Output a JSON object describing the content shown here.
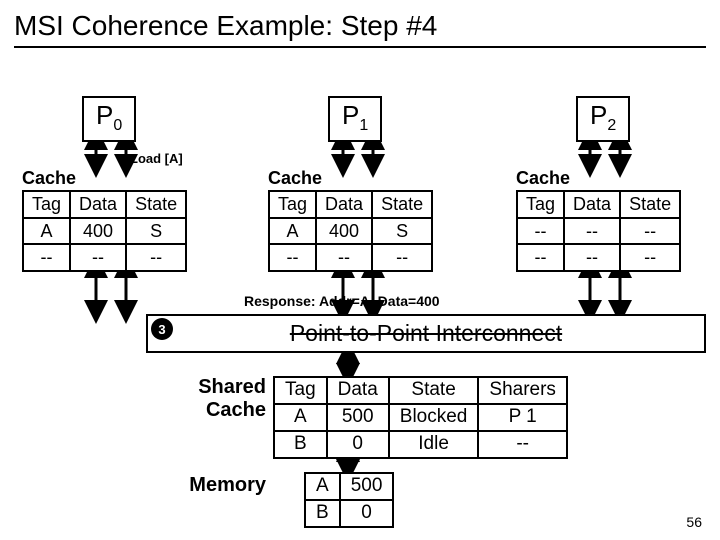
{
  "title": "MSI Coherence Example: Step #4",
  "procs": {
    "p0": "P",
    "p0sub": "0",
    "p1": "P",
    "p1sub": "1",
    "p2": "P",
    "p2sub": "2"
  },
  "load_label": "Load [A]",
  "cache_label": "Cache",
  "cache_headers": {
    "tag": "Tag",
    "data": "Data",
    "state": "State"
  },
  "cache0": [
    {
      "tag": "A",
      "data": "400",
      "state": "S"
    },
    {
      "tag": "--",
      "data": "--",
      "state": "--"
    }
  ],
  "cache1": [
    {
      "tag": "A",
      "data": "400",
      "state": "S"
    },
    {
      "tag": "--",
      "data": "--",
      "state": "--"
    }
  ],
  "cache2": [
    {
      "tag": "--",
      "data": "--",
      "state": "--"
    },
    {
      "tag": "--",
      "data": "--",
      "state": "--"
    }
  ],
  "step_number": "3",
  "interconnect_text": "Point-to-Point Interconnect",
  "response_text": "Response: Addr=A, Data=400",
  "shared_label1": "Shared",
  "shared_label2": "Cache",
  "shared_headers": {
    "tag": "Tag",
    "data": "Data",
    "state": "State",
    "sharers": "Sharers"
  },
  "shared_rows": [
    {
      "tag": "A",
      "data": "500",
      "state": "Blocked",
      "sharers": "P 1"
    },
    {
      "tag": "B",
      "data": "0",
      "state": "Idle",
      "sharers": "--"
    }
  ],
  "memory_label": "Memory",
  "memory_rows": [
    {
      "tag": "A",
      "data": "500"
    },
    {
      "tag": "B",
      "data": "0"
    }
  ],
  "pagenum": "56"
}
